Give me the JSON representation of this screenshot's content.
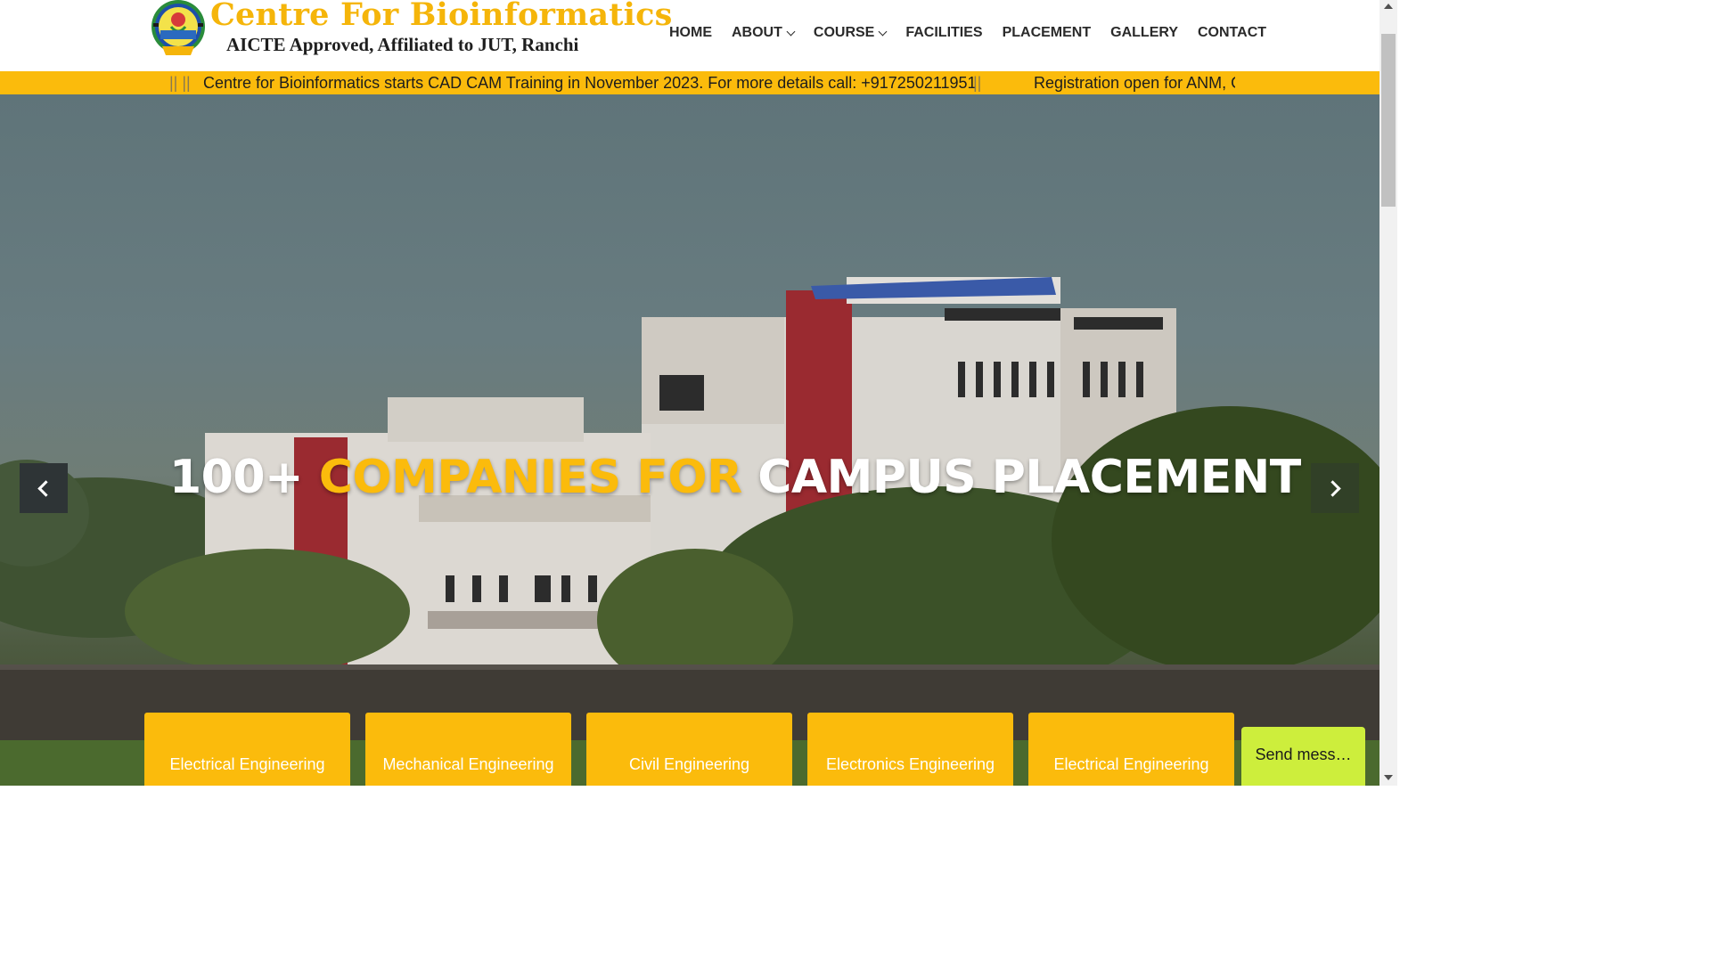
{
  "brand": {
    "title": "Centre For Bioinformatics",
    "subtitle": "AICTE Approved, Affiliated to JUT, Ranchi"
  },
  "nav": {
    "items": [
      {
        "label": "HOME",
        "dropdown": false
      },
      {
        "label": "ABOUT",
        "dropdown": true
      },
      {
        "label": "COURSE",
        "dropdown": true
      },
      {
        "label": "FACILITIES",
        "dropdown": false
      },
      {
        "label": "PLACEMENT",
        "dropdown": false
      },
      {
        "label": "GALLERY",
        "dropdown": false
      },
      {
        "label": "CONTACT",
        "dropdown": false
      }
    ]
  },
  "ticker": {
    "separator_left": "|| ||",
    "message1": "Centre for Bioinformatics starts CAD CAM Training in November 2023. For more details call: +917250211951",
    "separator_mid": "||",
    "message2": "Registration open for ANM, G"
  },
  "hero": {
    "headline_part1": "100+ ",
    "headline_part2": "COMPANIES FOR ",
    "headline_part3": "CAMPUS PLACEMENT"
  },
  "cards": [
    {
      "label": "Electrical Engineering"
    },
    {
      "label": "Mechanical Engineering"
    },
    {
      "label": "Civil Engineering"
    },
    {
      "label": "Electronics Engineering"
    },
    {
      "label": "Electrical Engineering"
    }
  ],
  "chat": {
    "label": "Send mess…"
  },
  "colors": {
    "accent": "#fbbb0c",
    "chat": "#cdee3c",
    "nav_text": "#2a2a2a"
  }
}
